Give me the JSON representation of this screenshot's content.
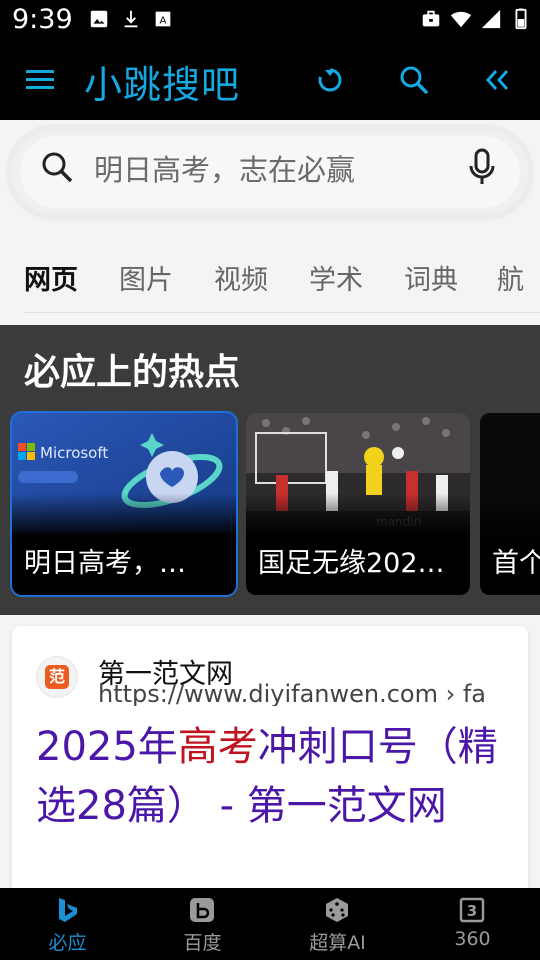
{
  "status_bar": {
    "time": "9:39",
    "icons_left": [
      "image-icon",
      "download-icon",
      "text-icon"
    ],
    "icons_right": [
      "briefcase-icon",
      "wifi-icon",
      "signal-icon",
      "battery-icon"
    ]
  },
  "app_bar": {
    "title": "小跳搜吧",
    "accent_color": "#14a9e1",
    "icons": [
      "menu-icon",
      "refresh-icon",
      "search-icon",
      "collapse-icon"
    ]
  },
  "search": {
    "value": "明日高考，志在必赢"
  },
  "tabs": [
    {
      "label": "网页",
      "active": true
    },
    {
      "label": "图片",
      "active": false
    },
    {
      "label": "视频",
      "active": false
    },
    {
      "label": "学术",
      "active": false
    },
    {
      "label": "词典",
      "active": false
    },
    {
      "label": "航",
      "active": false
    }
  ],
  "hot": {
    "title": "必应上的热点",
    "cards": [
      {
        "caption": "明日高考，…",
        "image_text": "Microsoft"
      },
      {
        "caption": "国足无缘202…"
      },
      {
        "caption": "首个"
      }
    ]
  },
  "result": {
    "favicon_text": "范",
    "site_name": "第一范文网",
    "url": "https://www.diyifanwen.com › fa",
    "title_part1": "2025年",
    "title_highlight": "高考",
    "title_part2": "冲刺口号（精选28篇） - 第一范文网",
    "title_color": "#4b17a8",
    "highlight_color": "#c1121f"
  },
  "bottom_nav": {
    "items": [
      {
        "label": "必应",
        "icon": "bing-icon",
        "active": true
      },
      {
        "label": "百度",
        "icon": "baidu-icon",
        "active": false
      },
      {
        "label": "超算AI",
        "icon": "dice-icon",
        "active": false
      },
      {
        "label": "360",
        "icon": "number3-icon",
        "active": false
      }
    ]
  }
}
